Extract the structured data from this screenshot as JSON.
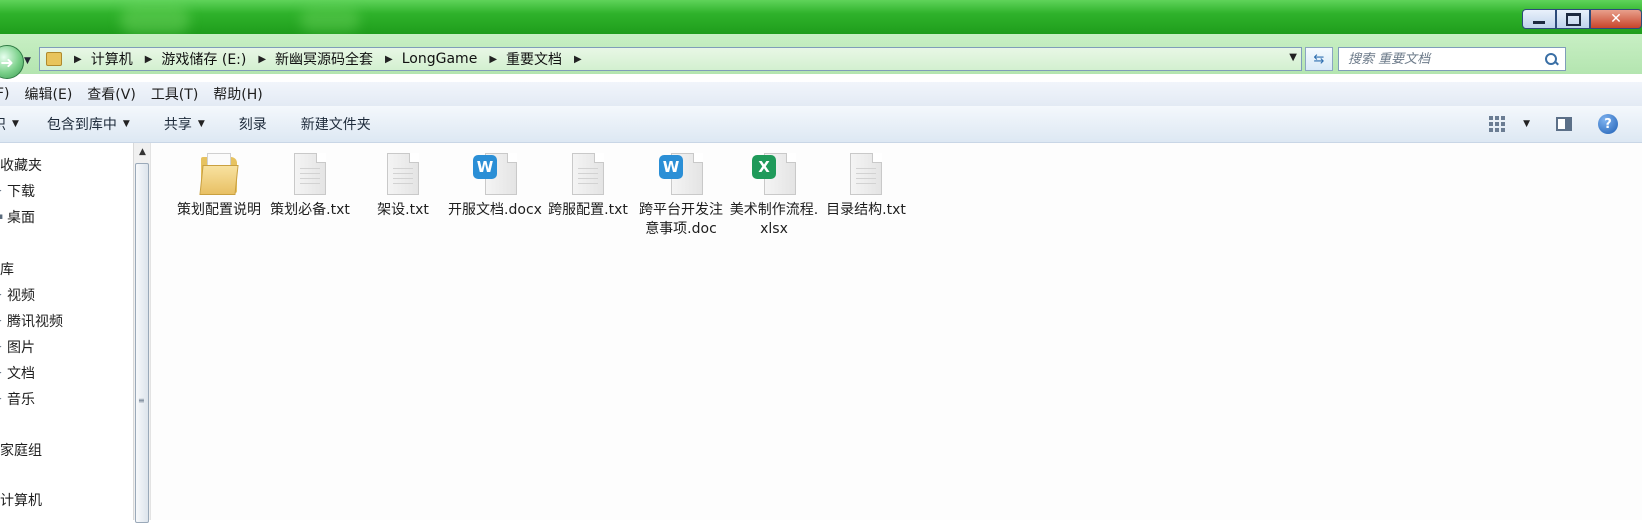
{
  "window": {
    "minimize_icon": "minimize-icon",
    "maximize_icon": "maximize-icon",
    "close_label": "✕"
  },
  "address": {
    "breadcrumbs": [
      "计算机",
      "游戏储存 (E:)",
      "新幽冥源码全套",
      "LongGame",
      "重要文档"
    ]
  },
  "search": {
    "placeholder": "搜索 重要文档"
  },
  "menubar": {
    "items": [
      "F)",
      "编辑(E)",
      "查看(V)",
      "工具(T)",
      "帮助(H)"
    ]
  },
  "toolbar": {
    "items": [
      {
        "label": "织",
        "has_dropdown": true
      },
      {
        "label": "包含到库中",
        "has_dropdown": true
      },
      {
        "label": "共享",
        "has_dropdown": true
      },
      {
        "label": "刻录",
        "has_dropdown": false
      },
      {
        "label": "新建文件夹",
        "has_dropdown": false
      }
    ]
  },
  "navpane": {
    "items": [
      {
        "label": "收藏夹",
        "level": 0
      },
      {
        "label": "下载",
        "level": 1
      },
      {
        "label": "桌面",
        "level": 1
      },
      {
        "label": "库",
        "level": 0
      },
      {
        "label": "视频",
        "level": 1
      },
      {
        "label": "腾讯视频",
        "level": 1
      },
      {
        "label": "图片",
        "level": 1
      },
      {
        "label": "文档",
        "level": 1
      },
      {
        "label": "音乐",
        "level": 1
      },
      {
        "label": "家庭组",
        "level": 0
      },
      {
        "label": "计算机",
        "level": 0
      }
    ]
  },
  "files": [
    {
      "name": "策划配置说明",
      "icon": "folder-icon"
    },
    {
      "name": "策划必备.txt",
      "icon": "text-file-icon"
    },
    {
      "name": "架设.txt",
      "icon": "text-file-icon"
    },
    {
      "name": "开服文档.docx",
      "icon": "wps-writer-icon"
    },
    {
      "name": "跨服配置.txt",
      "icon": "text-file-icon"
    },
    {
      "name": "跨平台开发注意事项.doc",
      "icon": "wps-writer-icon"
    },
    {
      "name": "美术制作流程.xlsx",
      "icon": "wps-spreadsheet-icon"
    },
    {
      "name": "目录结构.txt",
      "icon": "text-file-icon"
    }
  ],
  "colors": {
    "titlebar": "#2fb22b",
    "address_bar": "#c8efc4",
    "wps_writer": "#2b8fd6",
    "wps_spreadsheet": "#1f9a5a"
  }
}
